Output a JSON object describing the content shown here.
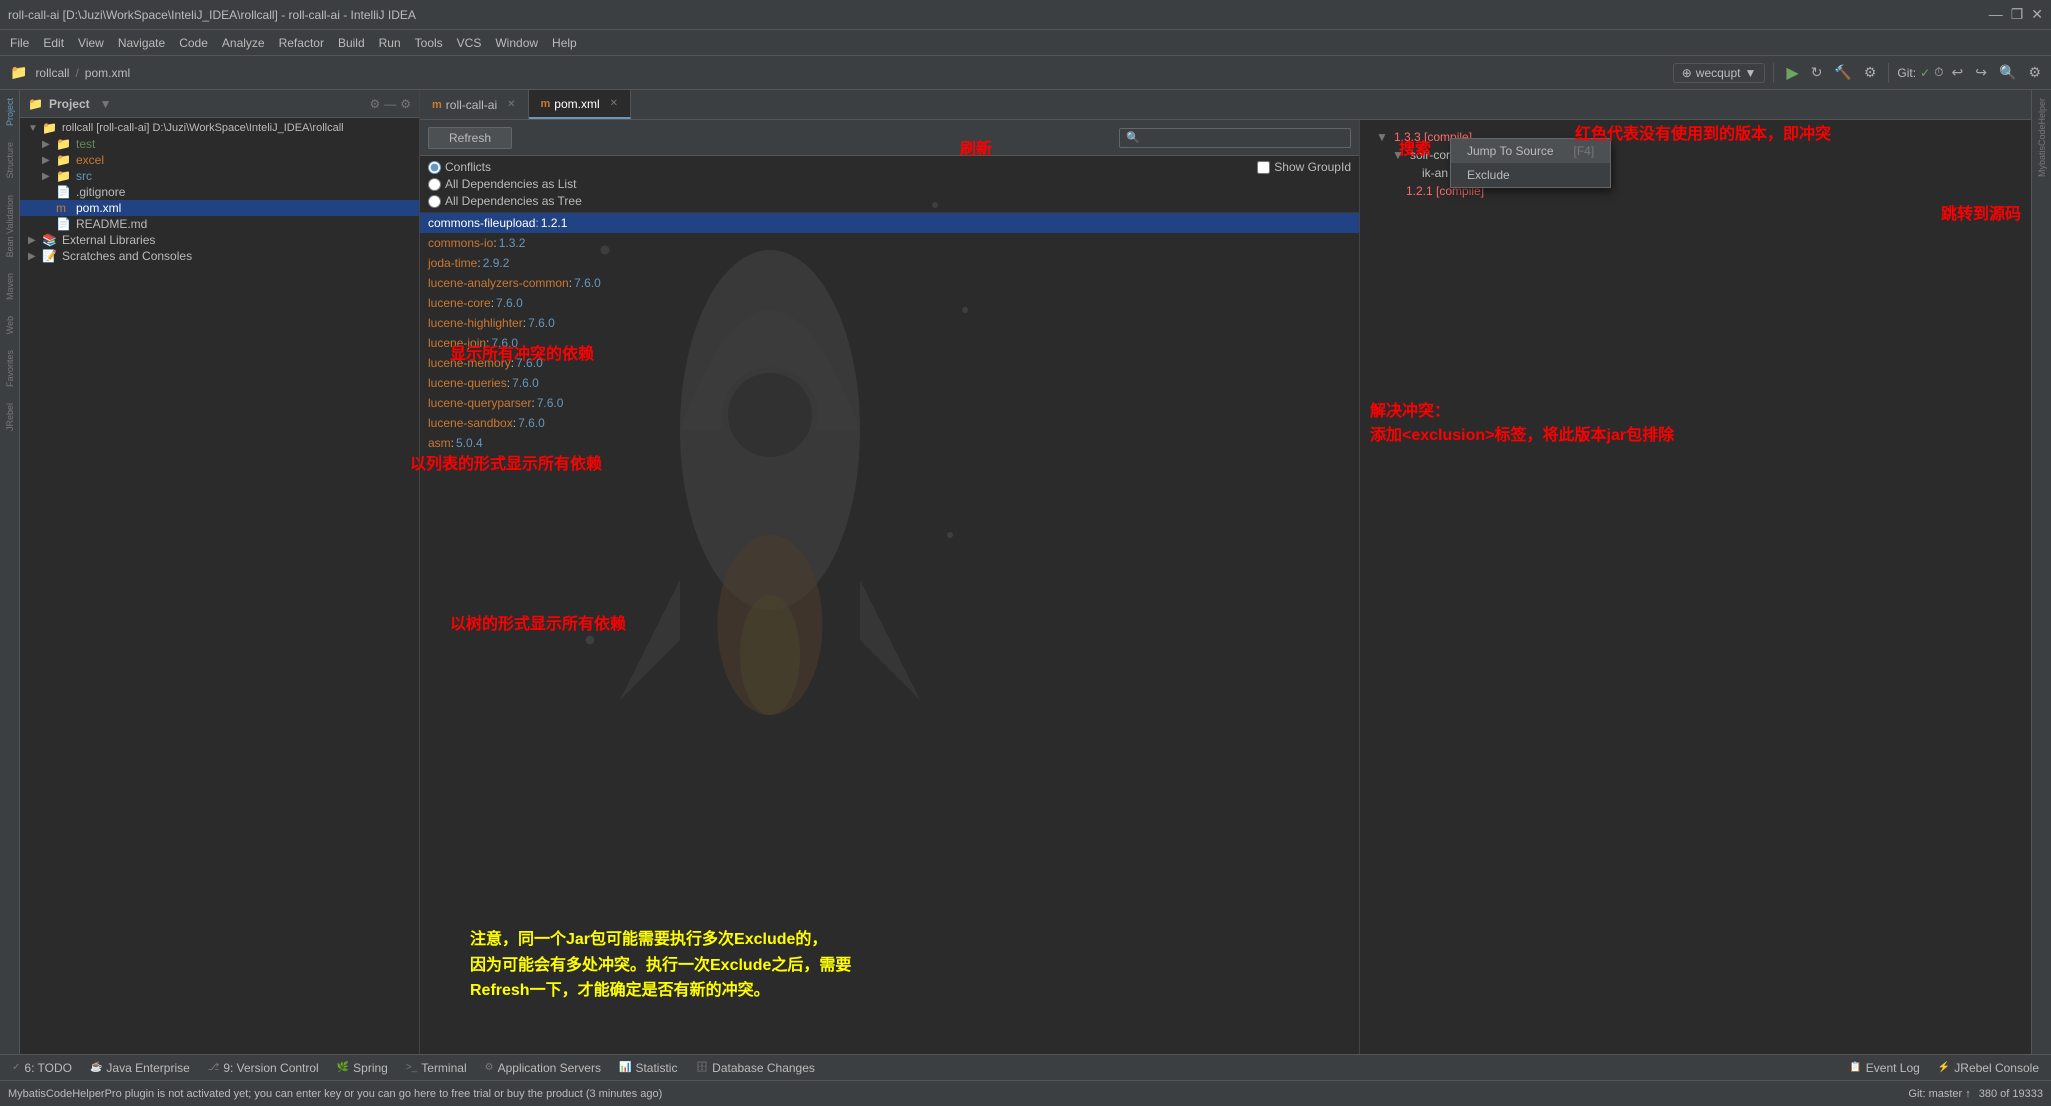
{
  "titleBar": {
    "title": "roll-call-ai [D:\\Juzi\\WorkSpace\\InteliJ_IDEA\\rollcall] - roll-call-ai - IntelliJ IDEA",
    "controls": [
      "—",
      "❐",
      "✕"
    ]
  },
  "menuBar": {
    "items": [
      "File",
      "Edit",
      "View",
      "Navigate",
      "Code",
      "Analyze",
      "Refactor",
      "Build",
      "Run",
      "Tools",
      "VCS",
      "Window",
      "Help"
    ]
  },
  "toolbar": {
    "projectName": "rollcall",
    "fileName": "pom.xml",
    "branchLabel": "wecqupt",
    "gitLabel": "Git:",
    "runIcon": "▶",
    "debugIcon": "🐛"
  },
  "projectPanel": {
    "title": "Project",
    "rootItem": "rollcall [roll-call-ai] D:\\Juzi\\WorkSpace\\InteliJ_IDEA\\rollcall",
    "items": [
      {
        "label": "test",
        "type": "folder",
        "color": "green",
        "indent": 2
      },
      {
        "label": "excel",
        "type": "folder",
        "color": "orange",
        "indent": 2
      },
      {
        "label": "src",
        "type": "folder",
        "color": "blue",
        "indent": 2
      },
      {
        "label": ".gitignore",
        "type": "file",
        "indent": 2
      },
      {
        "label": "pom.xml",
        "type": "xml",
        "indent": 2
      },
      {
        "label": "README.md",
        "type": "md",
        "indent": 2
      },
      {
        "label": "External Libraries",
        "type": "folder",
        "indent": 1
      },
      {
        "label": "Scratches and Consoles",
        "type": "folder",
        "indent": 1
      }
    ]
  },
  "fileTabs": [
    {
      "label": "roll-call-ai",
      "icon": "m",
      "active": false
    },
    {
      "label": "pom.xml",
      "icon": "m",
      "active": true
    }
  ],
  "dependencyPanel": {
    "refreshLabel": "Refresh",
    "searchPlaceholder": "🔍",
    "filters": {
      "conflicts": "Conflicts",
      "allList": "All Dependencies as List",
      "allTree": "All Dependencies as Tree",
      "showGroupId": "Show GroupId"
    },
    "conflictItems": [
      {
        "name": "commons-fileupload",
        "version": "1.2.1",
        "selected": true,
        "conflict": true
      },
      {
        "name": "commons-io",
        "version": "1.3.2",
        "conflict": false
      },
      {
        "name": "joda-time",
        "version": "2.9.2",
        "conflict": false
      },
      {
        "name": "lucene-analyzers-common",
        "version": "7.6.0",
        "conflict": false
      },
      {
        "name": "lucene-core",
        "version": "7.6.0",
        "conflict": false
      },
      {
        "name": "lucene-highlighter",
        "version": "7.6.0",
        "conflict": false
      },
      {
        "name": "lucene-join",
        "version": "7.6.0",
        "conflict": false
      },
      {
        "name": "lucene-memory",
        "version": "7.6.0",
        "conflict": false
      },
      {
        "name": "lucene-queries",
        "version": "7.6.0",
        "conflict": false
      },
      {
        "name": "lucene-queryparser",
        "version": "7.6.0",
        "conflict": false
      },
      {
        "name": "lucene-sandbox",
        "version": "7.6.0",
        "conflict": false
      },
      {
        "name": "asm",
        "version": "5.0.4",
        "conflict": false
      }
    ],
    "treeItems": [
      {
        "name": "1.3.3 [compile]",
        "indent": 0,
        "expanded": true,
        "version": "",
        "versionColor": "red"
      },
      {
        "name": "solr-cor",
        "indent": 1,
        "expanded": true,
        "version": "",
        "versionColor": "normal"
      },
      {
        "name": "ik-an",
        "indent": 2,
        "version": "",
        "versionColor": "normal"
      },
      {
        "name": "1.2.1 [compile]",
        "indent": 1,
        "version": "",
        "versionColor": "red"
      }
    ]
  },
  "contextMenu": {
    "items": [
      {
        "label": "Jump To Source",
        "shortcut": "[F4]"
      },
      {
        "label": "Exclude",
        "shortcut": ""
      }
    ]
  },
  "annotations": {
    "refresh": "刷新",
    "search": "搜索",
    "redMeaning": "红色代表没有使用到的版本，即冲突",
    "jumpToSource": "跳转到源码",
    "showConflicts": "显示所有冲突的依赖",
    "showAsList": "以列表的形式显示所有依赖",
    "showAsTree": "以树的形式显示所有依赖",
    "resolveConflict": "解决冲突：\n添加<exclusion>标签，将此版本jar包排除",
    "note": "注意，同一个Jar包可能需要执行多次Exclude的，\n因为可能会有多处冲突。执行一次Exclude之后，需要\nRefresh一下，才能确定是否有新的冲突。"
  },
  "bottomTabs": [
    {
      "label": "6: TODO",
      "icon": "✓",
      "active": false
    },
    {
      "label": "Java Enterprise",
      "icon": "☕",
      "active": false
    },
    {
      "label": "9: Version Control",
      "icon": "⎇",
      "active": false
    },
    {
      "label": "Spring",
      "icon": "🌿",
      "active": false
    },
    {
      "label": "Terminal",
      "icon": ">_",
      "active": false
    },
    {
      "label": "Application Servers",
      "icon": "⚙",
      "active": false
    },
    {
      "label": "Statistic",
      "icon": "📊",
      "active": false
    },
    {
      "label": "Database Changes",
      "icon": "🗄",
      "active": false
    }
  ],
  "bottomTabsRight": [
    {
      "label": "Event Log",
      "icon": "📋"
    },
    {
      "label": "JRebel Console",
      "icon": "⚡"
    }
  ],
  "statusBar": {
    "message": "MybatisCodeHelperPro plugin is not activated yet; you can enter key or you can go here to free trial or buy the product (3 minutes ago)",
    "branch": "Git: master ↑",
    "lineCol": "380 of 19333"
  }
}
